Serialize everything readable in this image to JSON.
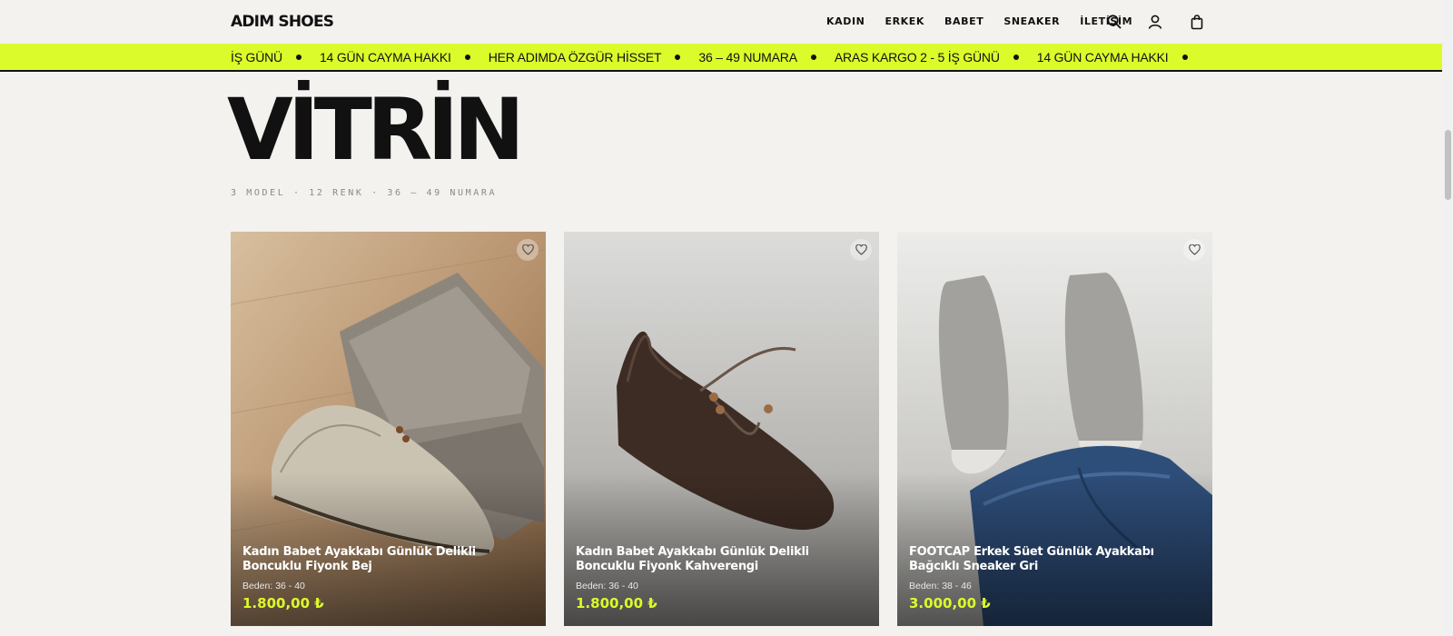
{
  "brand": "ADIM SHOES",
  "nav": [
    "KADIN",
    "ERKEK",
    "BABET",
    "SNEAKER",
    "İLETİŞİM"
  ],
  "header_icons": [
    "search-icon",
    "user-icon",
    "bag-icon"
  ],
  "marquee": [
    "İŞ GÜNÜ",
    "14 GÜN CAYMA HAKKI",
    "HER ADIMDA ÖZGÜR HİSSET",
    "36 – 49 NUMARA",
    "ARAS KARGO 2 - 5 İŞ GÜNÜ",
    "14 GÜN CAYMA HAKKI"
  ],
  "hero": {
    "title": "VİTRİN",
    "subtitle": "3 MODEL · 12 RENK · 36 – 49 NUMARA"
  },
  "products": [
    {
      "name": "Kadın Babet Ayakkabı Günlük Delikli Boncuklu Fiyonk Bej",
      "size": "Beden: 36 - 40",
      "price": "1.800,00 ₺"
    },
    {
      "name": "Kadın Babet Ayakkabı Günlük Delikli Boncuklu Fiyonk Kahverengi",
      "size": "Beden: 36 - 40",
      "price": "1.800,00 ₺"
    },
    {
      "name": "FOOTCAP Erkek Süet Günlük Ayakkabı Bağcıklı Sneaker Gri",
      "size": "Beden: 38 - 46",
      "price": "3.000,00 ₺"
    }
  ],
  "colors": {
    "accent": "#dcfb2b",
    "background": "#f3f2ef",
    "text": "#111111"
  }
}
